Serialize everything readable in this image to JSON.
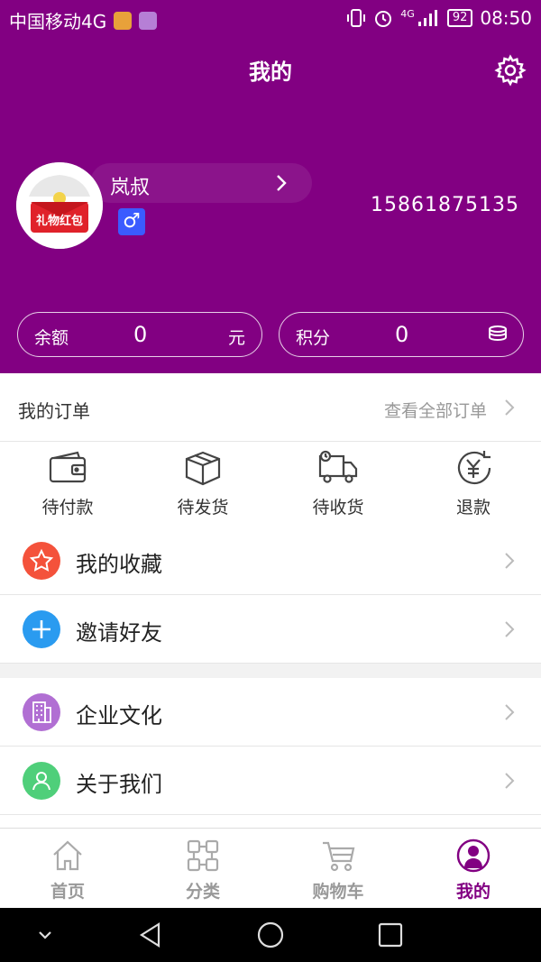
{
  "status_bar": {
    "carrier": "中国移动4G",
    "network": "4G",
    "battery": "92",
    "time": "08:50"
  },
  "header": {
    "title": "我的"
  },
  "profile": {
    "avatar_text": "礼物红包",
    "name": "岚叔",
    "gender": "♂",
    "phone": "15861875135"
  },
  "stats": [
    {
      "label": "余额",
      "value": "0",
      "unit": "元"
    },
    {
      "label": "积分",
      "value": "0"
    }
  ],
  "orders": {
    "title": "我的订单",
    "view_all": "查看全部订单",
    "items": [
      {
        "label": "待付款",
        "icon": "wallet-icon"
      },
      {
        "label": "待发货",
        "icon": "box-icon"
      },
      {
        "label": "待收货",
        "icon": "truck-icon"
      },
      {
        "label": "退款",
        "icon": "refund-icon"
      }
    ]
  },
  "menu": [
    {
      "label": "我的收藏",
      "icon": "star-icon",
      "color": "#f4523b"
    },
    {
      "label": "邀请好友",
      "icon": "plus-icon",
      "color": "#2a9bf0"
    },
    {
      "label": "企业文化",
      "icon": "building-icon",
      "color": "#b16fd3"
    },
    {
      "label": "关于我们",
      "icon": "person-icon",
      "color": "#4fcf7a"
    }
  ],
  "tabbar": {
    "items": [
      {
        "label": "首页",
        "icon": "home-icon"
      },
      {
        "label": "分类",
        "icon": "category-icon"
      },
      {
        "label": "购物车",
        "icon": "cart-icon"
      },
      {
        "label": "我的",
        "icon": "profile-icon",
        "active": true
      }
    ]
  },
  "colors": {
    "brand": "#820082",
    "tab_active": "#820082",
    "tab_inactive": "#999999"
  }
}
